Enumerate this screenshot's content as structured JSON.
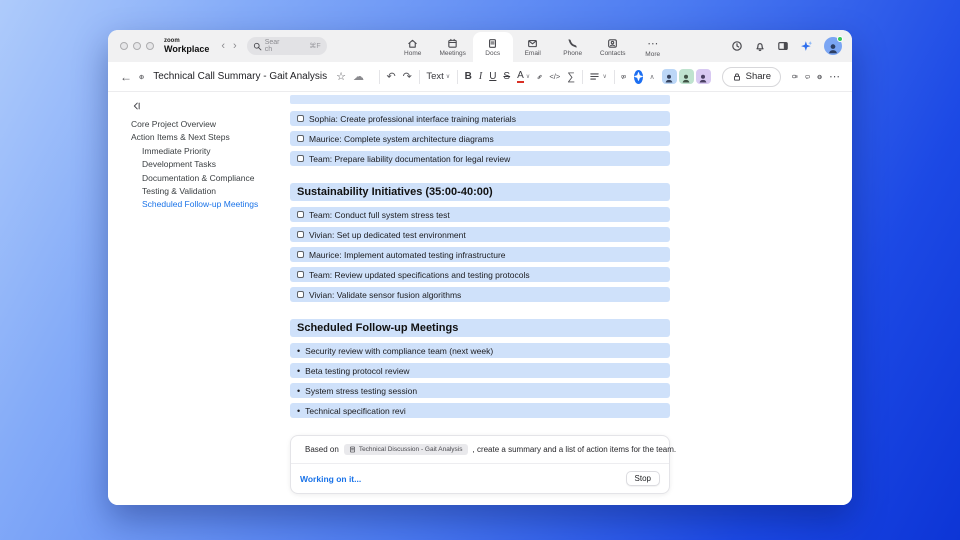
{
  "colors": {
    "accent": "#1a73e8",
    "row_highlight": "#cfe1fa",
    "ai_button": "#1d6ff2",
    "titlebar_bg": "#f1f1f2"
  },
  "icons": {
    "undo": "↶",
    "redo": "↷",
    "more": "⋯",
    "star": "☆",
    "cloud": "☁",
    "sigma": "∑",
    "chevron_down": "∨",
    "chevron_up": "∧",
    "back": "←",
    "nav_back": "‹",
    "nav_forward": "›",
    "bullet": "•"
  },
  "titlebar": {
    "logo_top": "zoom",
    "logo_bottom": "Workplace",
    "search_placeholder": "Search",
    "search_shortcut": "⌘F",
    "nav": [
      {
        "label": "Home"
      },
      {
        "label": "Meetings"
      },
      {
        "label": "Docs"
      },
      {
        "label": "Email"
      },
      {
        "label": "Phone"
      },
      {
        "label": "Contacts"
      },
      {
        "label": "More"
      }
    ]
  },
  "toolbar": {
    "doc_title": "Technical Call Summary - Gait Analysis",
    "text_style_label": "Text",
    "bold_label": "B",
    "italic_label": "I",
    "underline_label": "U",
    "strike_label": "S",
    "color_label": "A",
    "code_label": "</>",
    "share_label": "Share"
  },
  "outline": {
    "items": [
      {
        "label": "Core Project Overview"
      },
      {
        "label": "Action Items & Next Steps"
      },
      {
        "label": "Immediate Priority"
      },
      {
        "label": "Development Tasks"
      },
      {
        "label": "Documentation & Compliance"
      },
      {
        "label": "Testing & Validation"
      },
      {
        "label": "Scheduled Follow-up Meetings"
      }
    ]
  },
  "document": {
    "top_tasks": [
      "Sophia: Create professional interface training materials",
      "Maurice: Complete system architecture diagrams",
      "Team: Prepare liability documentation for legal review"
    ],
    "section1": {
      "heading": "Sustainability Initiatives (35:00-40:00)",
      "items": [
        "Team: Conduct full system stress test",
        "Vivian: Set up dedicated test environment",
        "Maurice: Implement automated testing infrastructure",
        "Team: Review updated specifications and testing protocols",
        "Vivian: Validate sensor fusion algorithms"
      ]
    },
    "section2": {
      "heading": "Scheduled Follow-up Meetings",
      "items": [
        "Security review with compliance team (next week)",
        "Beta testing protocol review",
        "System stress testing session",
        "Technical specification revi"
      ]
    }
  },
  "ai_panel": {
    "prefix": "Based on",
    "source_chip": "Technical Discussion - Gait Analysis",
    "suffix": ", create a summary and a list of action items for the team.",
    "status": "Working on it...",
    "stop_label": "Stop"
  }
}
